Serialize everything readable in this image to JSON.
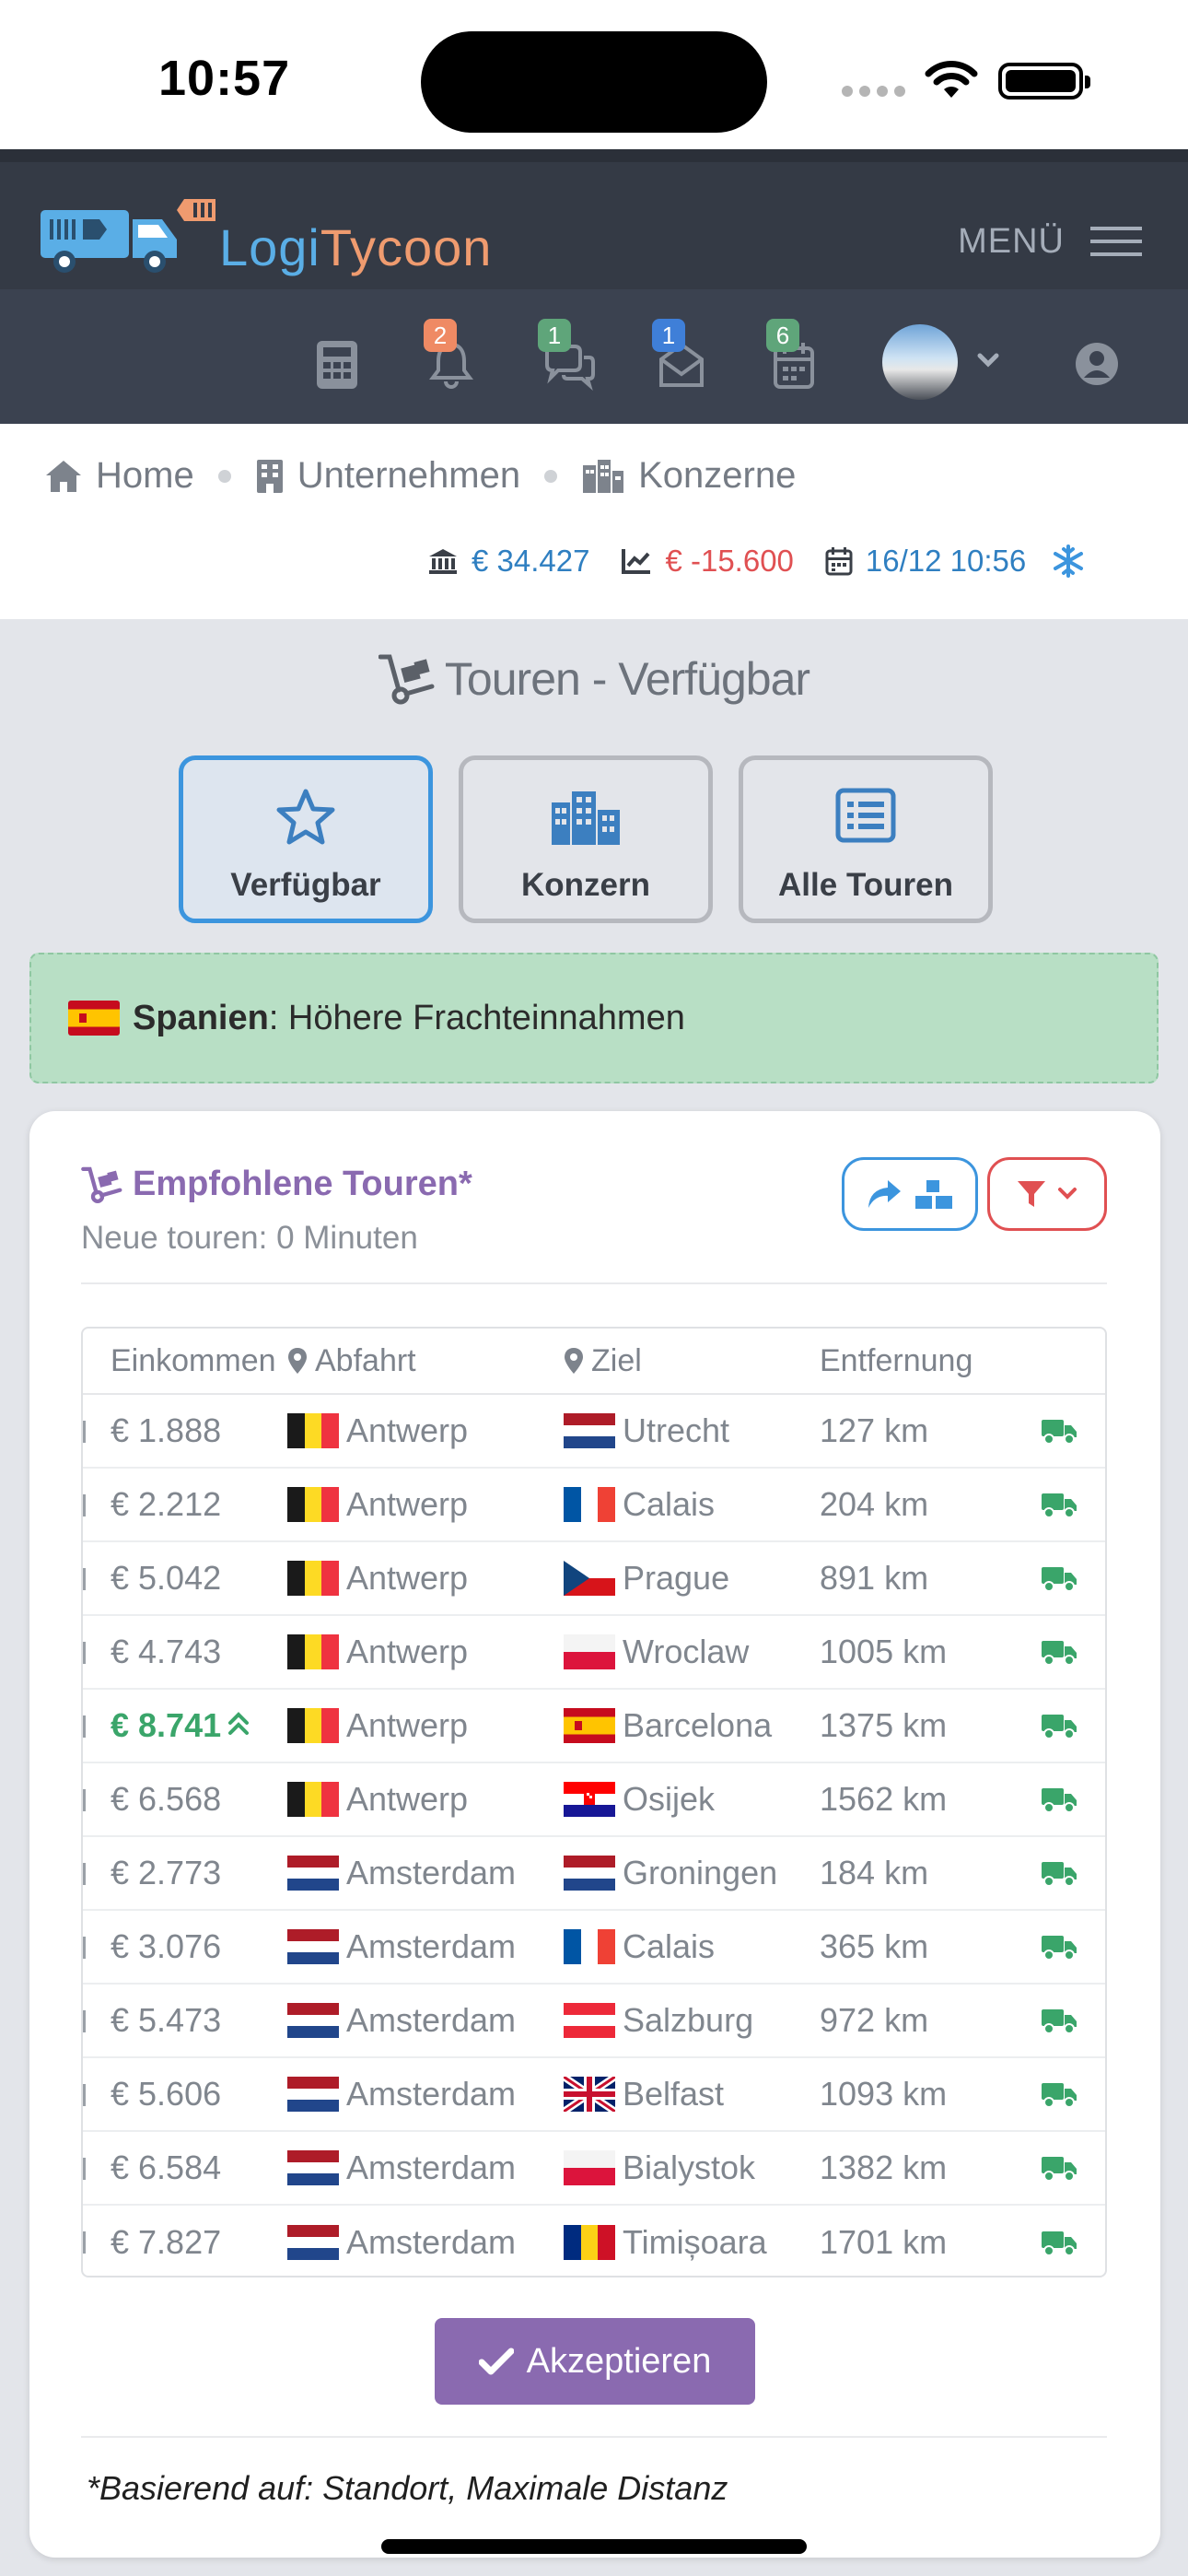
{
  "status_bar": {
    "time": "10:57"
  },
  "brand": {
    "part1": "Logi",
    "part2": "Tycoon"
  },
  "header": {
    "menu_label": "MENÜ"
  },
  "toolbar": {
    "notifications_count": "2",
    "messages_count": "1",
    "mail_count": "1",
    "calendar_count": "6"
  },
  "breadcrumb": [
    "Home",
    "Unternehmen",
    "Konzerne"
  ],
  "stats": {
    "balance": "€ 34.427",
    "profit": "€ -15.600",
    "datetime": "16/12 10:56"
  },
  "page": {
    "title": "Touren - Verfügbar"
  },
  "tabs": [
    {
      "label": "Verfügbar",
      "icon": "star-icon",
      "active": true
    },
    {
      "label": "Konzern",
      "icon": "city-icon",
      "active": false
    },
    {
      "label": "Alle Touren",
      "icon": "list-icon",
      "active": false
    }
  ],
  "alert": {
    "country": "Spanien",
    "text": ": Höhere Frachteinnahmen",
    "color": "#b8dfc5"
  },
  "card": {
    "title": "Empfohlene Touren*",
    "subtitle": "Neue touren: 0 Minuten",
    "columns": [
      "Einkommen",
      "Abfahrt",
      "Ziel",
      "Entfernung"
    ],
    "rows": [
      {
        "income": "€ 1.888",
        "from_flag": "be",
        "from": "Antwerp",
        "to_flag": "nl",
        "to": "Utrecht",
        "distance": "127 km"
      },
      {
        "income": "€ 2.212",
        "from_flag": "be",
        "from": "Antwerp",
        "to_flag": "fr",
        "to": "Calais",
        "distance": "204 km"
      },
      {
        "income": "€ 5.042",
        "from_flag": "be",
        "from": "Antwerp",
        "to_flag": "cz",
        "to": "Prague",
        "distance": "891 km"
      },
      {
        "income": "€ 4.743",
        "from_flag": "be",
        "from": "Antwerp",
        "to_flag": "pl",
        "to": "Wroclaw",
        "distance": "1005 km"
      },
      {
        "income": "€ 8.741",
        "highlight": true,
        "from_flag": "be",
        "from": "Antwerp",
        "to_flag": "es",
        "to": "Barcelona",
        "distance": "1375 km"
      },
      {
        "income": "€ 6.568",
        "from_flag": "be",
        "from": "Antwerp",
        "to_flag": "hr",
        "to": "Osijek",
        "distance": "1562 km"
      },
      {
        "income": "€ 2.773",
        "from_flag": "nl",
        "from": "Amsterdam",
        "to_flag": "nl",
        "to": "Groningen",
        "distance": "184 km"
      },
      {
        "income": "€ 3.076",
        "from_flag": "nl",
        "from": "Amsterdam",
        "to_flag": "fr",
        "to": "Calais",
        "distance": "365 km"
      },
      {
        "income": "€ 5.473",
        "from_flag": "nl",
        "from": "Amsterdam",
        "to_flag": "at",
        "to": "Salzburg",
        "distance": "972 km"
      },
      {
        "income": "€ 5.606",
        "from_flag": "nl",
        "from": "Amsterdam",
        "to_flag": "gb",
        "to": "Belfast",
        "distance": "1093 km"
      },
      {
        "income": "€ 6.584",
        "from_flag": "nl",
        "from": "Amsterdam",
        "to_flag": "pl",
        "to": "Bialystok",
        "distance": "1382 km"
      },
      {
        "income": "€ 7.827",
        "from_flag": "nl",
        "from": "Amsterdam",
        "to_flag": "ro",
        "to": "Timișoara",
        "distance": "1701 km"
      }
    ],
    "accept_label": "Akzeptieren",
    "footnote": "*Basierend auf: Standort, Maximale Distanz"
  },
  "colors": {
    "accent_purple": "#8a6ab0",
    "accent_blue": "#3c95de",
    "danger": "#e05052",
    "success": "#3aa56a",
    "header_bg": "#343a45"
  }
}
